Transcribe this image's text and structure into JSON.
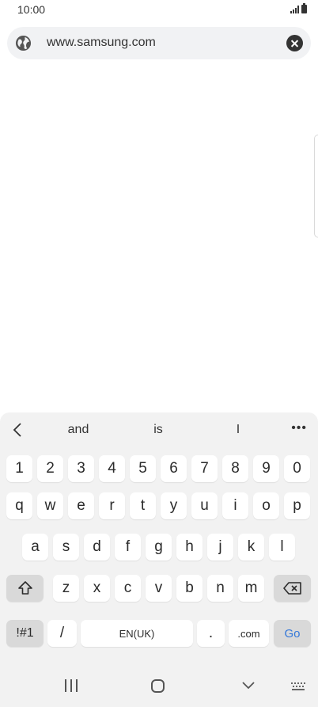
{
  "status": {
    "time": "10:00"
  },
  "browser": {
    "url": "www.samsung.com"
  },
  "keyboard": {
    "suggestions": [
      "and",
      "is",
      "I"
    ],
    "more_label": "•••",
    "row1": [
      "1",
      "2",
      "3",
      "4",
      "5",
      "6",
      "7",
      "8",
      "9",
      "0"
    ],
    "row2": [
      "q",
      "w",
      "e",
      "r",
      "t",
      "y",
      "u",
      "i",
      "o",
      "p"
    ],
    "row3": [
      "a",
      "s",
      "d",
      "f",
      "g",
      "h",
      "j",
      "k",
      "l"
    ],
    "row4": [
      "z",
      "x",
      "c",
      "v",
      "b",
      "n",
      "m"
    ],
    "symbols_label": "!#1",
    "slash_label": "/",
    "space_label": "EN(UK)",
    "period_label": ".",
    "dotcom_label": ".com",
    "go_label": "Go"
  },
  "icons": {
    "globe": "globe-icon",
    "clear": "clear-icon",
    "shift": "shift-icon",
    "backspace": "backspace-icon",
    "back": "chevron-left-icon"
  },
  "colors": {
    "go_key": "#3478d9",
    "url_bar_bg": "#f1f2f4",
    "keyboard_bg": "#f2f2f2"
  }
}
